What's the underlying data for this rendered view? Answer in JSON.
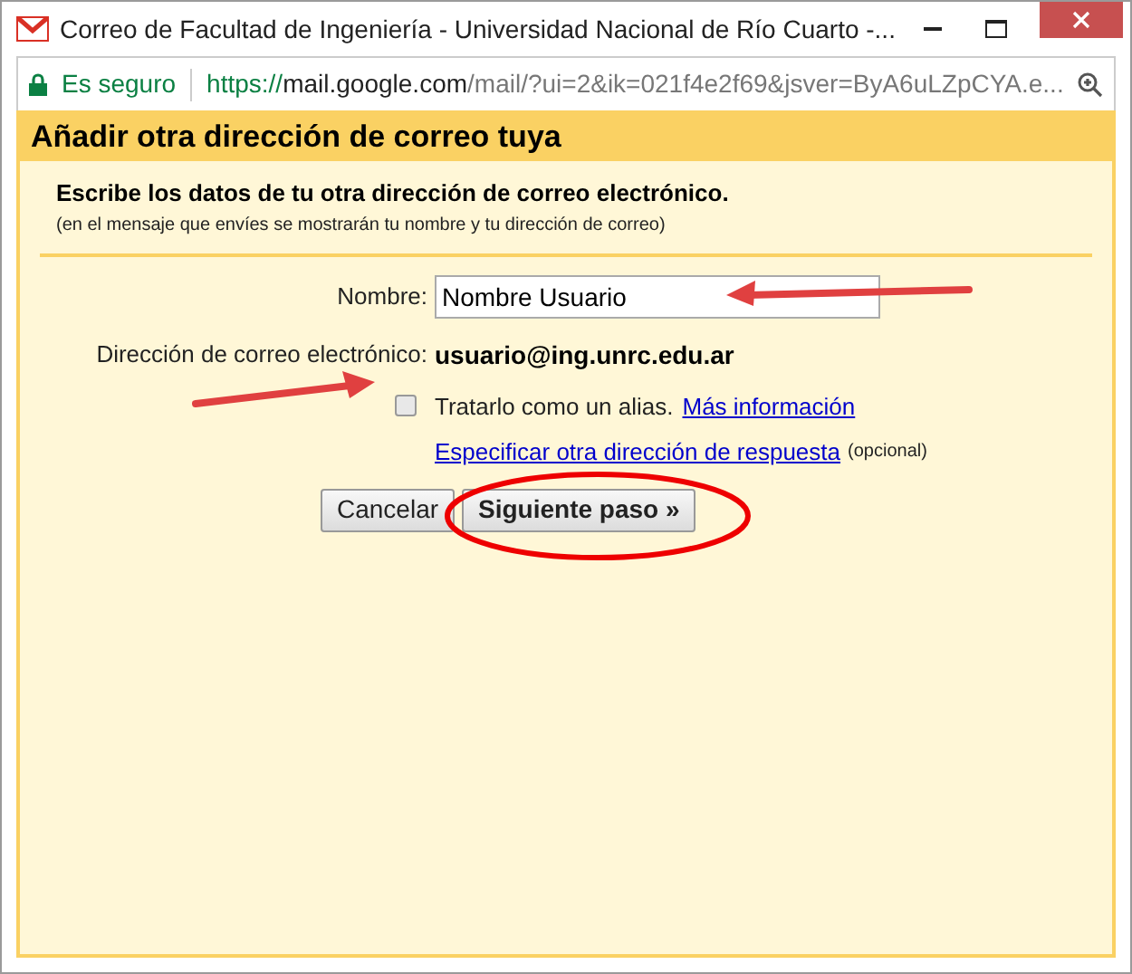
{
  "window": {
    "title": "Correo de Facultad de Ingeniería - Universidad Nacional de Río Cuarto -..."
  },
  "address_bar": {
    "security": "Es seguro",
    "url_scheme": "https://",
    "url_host": "mail.google.com",
    "url_path": "/mail/?ui=2&ik=021f4e2f69&jsver=ByA6uLZpCYA.e..."
  },
  "dialog": {
    "title": "Añadir otra dirección de correo tuya",
    "heading": "Escribe los datos de tu otra dirección de correo electrónico.",
    "note": "(en el mensaje que envíes se mostrarán tu nombre y tu dirección de correo)",
    "name_label": "Nombre:",
    "name_value": "Nombre Usuario",
    "email_label": "Dirección de correo electrónico:",
    "email_value": "usuario@ing.unrc.edu.ar",
    "alias": {
      "label": "Tratarlo como un alias.",
      "checked": false,
      "link": "Más información"
    },
    "reply_link": "Especificar otra dirección de respuesta",
    "reply_note": "(opcional)",
    "buttons": [
      "Cancelar",
      "Siguiente paso »"
    ]
  }
}
